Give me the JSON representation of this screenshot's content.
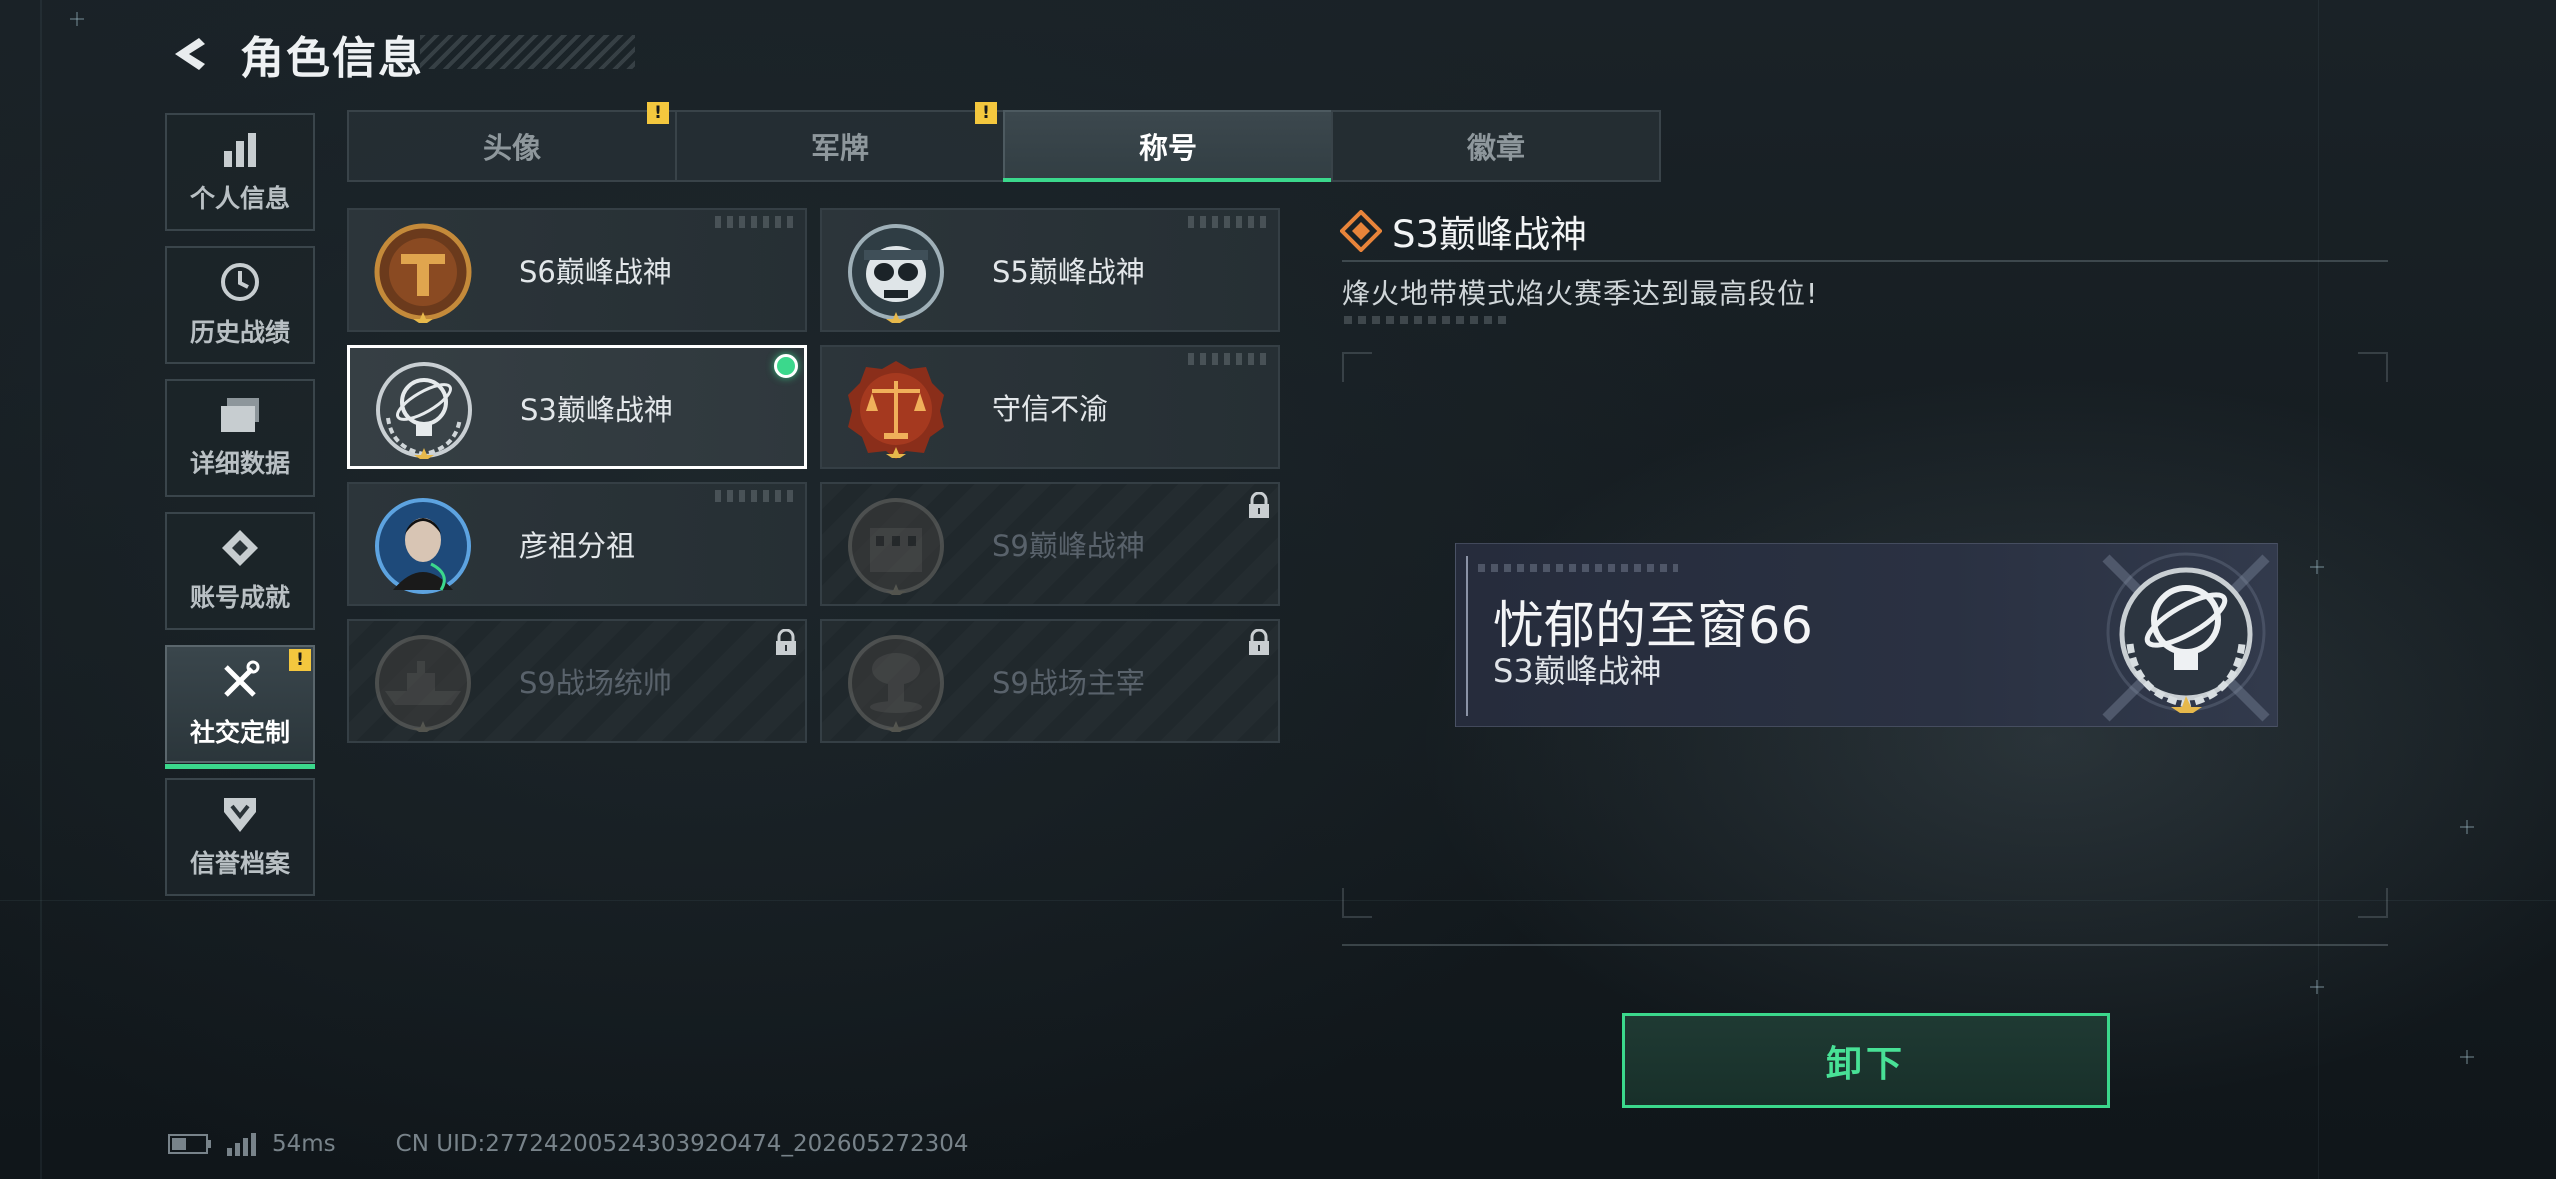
{
  "header": {
    "title": "角色信息"
  },
  "sidebar": {
    "items": [
      {
        "label": "个人信息",
        "icon": "bar-chart-icon"
      },
      {
        "label": "历史战绩",
        "icon": "clock-icon"
      },
      {
        "label": "详细数据",
        "icon": "folder-icon"
      },
      {
        "label": "账号成就",
        "icon": "achievement-icon"
      },
      {
        "label": "社交定制",
        "icon": "tools-icon",
        "active": true,
        "badge": "!"
      },
      {
        "label": "信誉档案",
        "icon": "credit-shield-icon"
      }
    ]
  },
  "tabs": [
    {
      "label": "头像",
      "badge": "!"
    },
    {
      "label": "军牌",
      "badge": "!"
    },
    {
      "label": "称号",
      "active": true
    },
    {
      "label": "徽章"
    }
  ],
  "titles": [
    {
      "name": "S6巅峰战神",
      "locked": false
    },
    {
      "name": "S5巅峰战神",
      "locked": false
    },
    {
      "name": "S3巅峰战神",
      "locked": false,
      "selected": true,
      "equipped": true
    },
    {
      "name": "守信不渝",
      "locked": false
    },
    {
      "name": "彦祖分祖",
      "locked": false
    },
    {
      "name": "S9巅峰战神",
      "locked": true
    },
    {
      "name": "S9战场统帅",
      "locked": true
    },
    {
      "name": "S9战场主宰",
      "locked": true
    }
  ],
  "detail": {
    "title": "S3巅峰战神",
    "description": "烽火地带模式焰火赛季达到最高段位!"
  },
  "preview": {
    "player_name": "忧郁的至窗66",
    "title": "S3巅峰战神"
  },
  "actions": {
    "unequip_label": "卸下"
  },
  "footer": {
    "ping": "54ms",
    "uid": "CN UID:2772420052430392O474_202605272304"
  },
  "colors": {
    "accent": "#3bd88c",
    "warning": "#f4c73e",
    "background": "#161d21"
  }
}
